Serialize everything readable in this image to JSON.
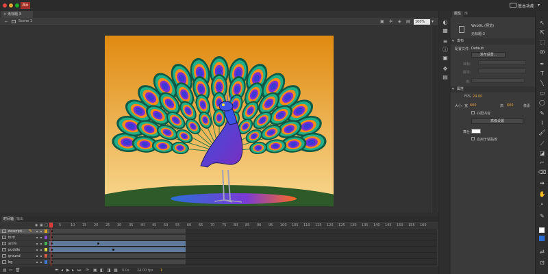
{
  "app": {
    "logo": "An",
    "workspace": "基本功能"
  },
  "document": {
    "tab": "无标题-3 (WebGL)",
    "close": "×"
  },
  "scene": {
    "label": "Scene 1",
    "zoom": "100%"
  },
  "timeline": {
    "tab": "时间轴",
    "output_tab": "输出",
    "frame_numbers": [
      "1",
      "5",
      "10",
      "15",
      "20",
      "25",
      "30",
      "35",
      "40",
      "45",
      "50",
      "55",
      "60",
      "65",
      "70",
      "75",
      "80",
      "85",
      "90",
      "95",
      "100",
      "105",
      "110",
      "115",
      "120",
      "125",
      "130",
      "135",
      "140",
      "145",
      "150",
      "155",
      "160"
    ],
    "layers": [
      {
        "name": "descript...",
        "active": true,
        "swatch": "#e0a020"
      },
      {
        "name": "bird",
        "active": false,
        "swatch": "#8a4fd6"
      },
      {
        "name": "anim",
        "active": false,
        "swatch": "#3fb34f"
      },
      {
        "name": "puddle",
        "active": false,
        "swatch": "#d6d63f"
      },
      {
        "name": "ground",
        "active": false,
        "swatch": "#d65a3f"
      },
      {
        "name": "bg",
        "active": false,
        "swatch": "#3f7ad6"
      }
    ],
    "current_time": "0.0s",
    "fps": "24.00 fps",
    "frame": "1"
  },
  "properties": {
    "tab": "属性",
    "library_tab": "库",
    "doc_type": "WebGL (预览)",
    "doc_name": "无标题-3",
    "publish_header": "发布",
    "profile_label": "配置文件:",
    "profile_value": "Default",
    "publish_settings_button": "发布设置...",
    "target_label": "目标:",
    "script_label": "脚本:",
    "class_label": "类:",
    "props_header": "属性",
    "fps_label": "FPS",
    "fps_value": "24.00",
    "size_label": "大小:",
    "width_value": "600",
    "width_unit": "宽",
    "height_unit": "高",
    "height_value": "600",
    "pixel_unit": "像素",
    "match_label": "匹配内容",
    "advanced_button": "高级设置",
    "stage_label": "舞台:",
    "apply_label": "应用于粘贴板"
  },
  "colors": {
    "sky_top": "#e08a10",
    "sky_bottom": "#f8d890",
    "ground": "#2e5a2a",
    "puddle": "#2a6fd6",
    "bird": "#4d3fc9",
    "feather_outer": "#1f9a7a",
    "feather_mid": "#ff8a1a",
    "feather_inner": "#3a3ad6"
  }
}
